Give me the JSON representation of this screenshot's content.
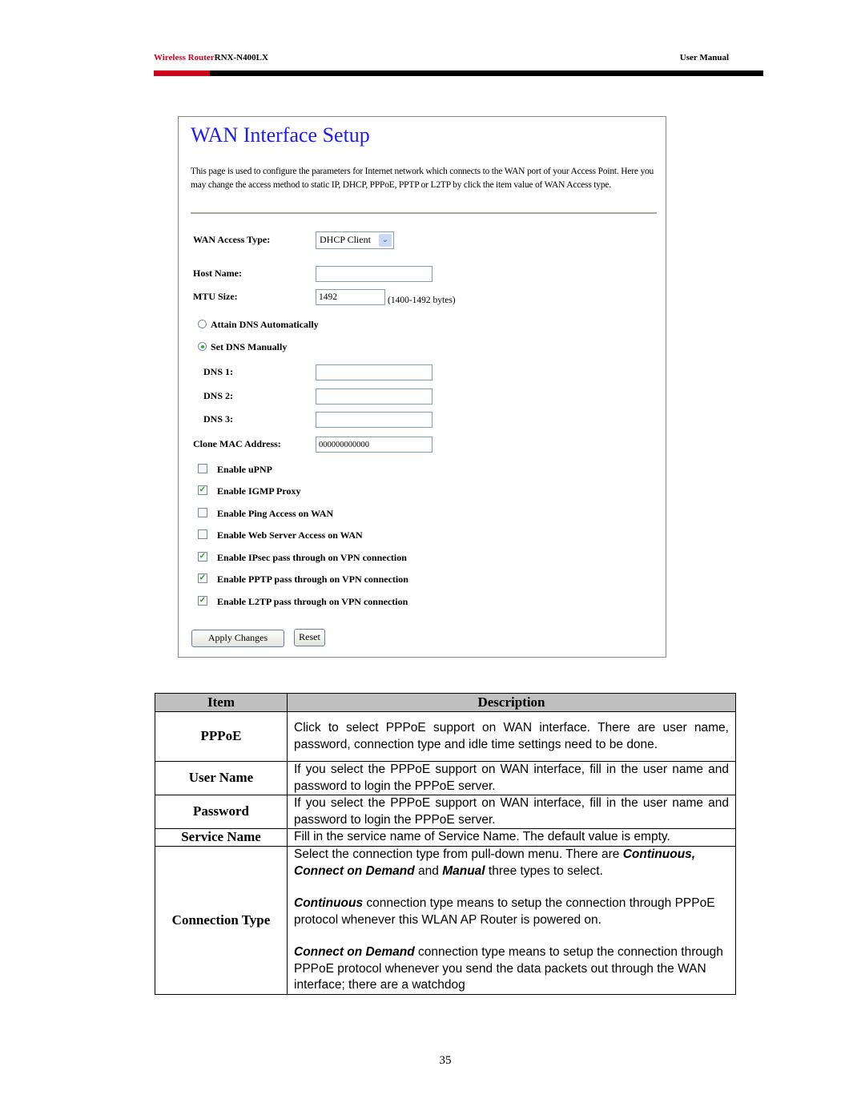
{
  "header": {
    "brand": "Wireless Router",
    "model": "RNX-N400LX",
    "doc_type": "User Manual",
    "accent_color": "#d0021b"
  },
  "screenshot": {
    "title": "WAN Interface Setup",
    "intro": "This page is used to configure the parameters for Internet network which connects to the WAN port of your Access Point. Here you may change the access method to static IP, DHCP, PPPoE, PPTP or L2TP by click the item value of WAN Access type.",
    "wan_access_type": {
      "label": "WAN Access Type:",
      "value": "DHCP Client"
    },
    "host_name": {
      "label": "Host Name:",
      "value": ""
    },
    "mtu_size": {
      "label": "MTU Size:",
      "value": "1492",
      "hint": "(1400-1492 bytes)"
    },
    "dns_mode": [
      {
        "label": "Attain DNS Automatically",
        "selected": false
      },
      {
        "label": "Set DNS Manually",
        "selected": true
      }
    ],
    "dns": [
      {
        "label": "DNS 1:",
        "value": ""
      },
      {
        "label": "DNS 2:",
        "value": ""
      },
      {
        "label": "DNS 3:",
        "value": ""
      }
    ],
    "clone_mac": {
      "label": "Clone MAC Address:",
      "value": "000000000000"
    },
    "options": [
      {
        "label": "Enable uPNP",
        "checked": false
      },
      {
        "label": "Enable IGMP Proxy",
        "checked": true
      },
      {
        "label": "Enable Ping Access on WAN",
        "checked": false
      },
      {
        "label": "Enable Web Server Access on WAN",
        "checked": false
      },
      {
        "label": "Enable IPsec pass through on VPN connection",
        "checked": true
      },
      {
        "label": "Enable PPTP pass through on VPN connection",
        "checked": true
      },
      {
        "label": "Enable L2TP pass through on VPN connection",
        "checked": true
      }
    ],
    "buttons": {
      "apply": "Apply Changes",
      "reset": "Reset"
    }
  },
  "table": {
    "headers": [
      "Item",
      "Description"
    ],
    "rows": [
      {
        "item": "PPPoE",
        "desc": "Click to select PPPoE support on WAN interface. There are user name, password, connection type and idle time settings need to be done."
      },
      {
        "item": "User Name",
        "desc": "If you select the PPPoE support on WAN interface, fill in the user name and password to login the PPPoE server."
      },
      {
        "item": "Password",
        "desc": "If you select the PPPoE support on WAN interface, fill in the user name and password to login the PPPoE server."
      },
      {
        "item": "Service Name",
        "desc": "Fill in the service name of Service Name. The default value is empty."
      }
    ],
    "connection_type": {
      "item": "Connection Type",
      "p1_a": "Select the connection type from pull-down menu. There are ",
      "p1_b": "Continuous, Connect on Demand",
      "p1_c": " and ",
      "p1_d": "Manual",
      "p1_e": " three types to select.",
      "p2_a": "Continuous",
      "p2_b": " connection type means to setup the connection through PPPoE protocol whenever this WLAN AP Router is powered on.",
      "p3_a": "Connect on Demand",
      "p3_b": " connection type means to setup the connection through PPPoE protocol whenever you send the data packets out through the WAN interface; there are a watchdog"
    }
  },
  "footer": {
    "page_number": "35"
  }
}
